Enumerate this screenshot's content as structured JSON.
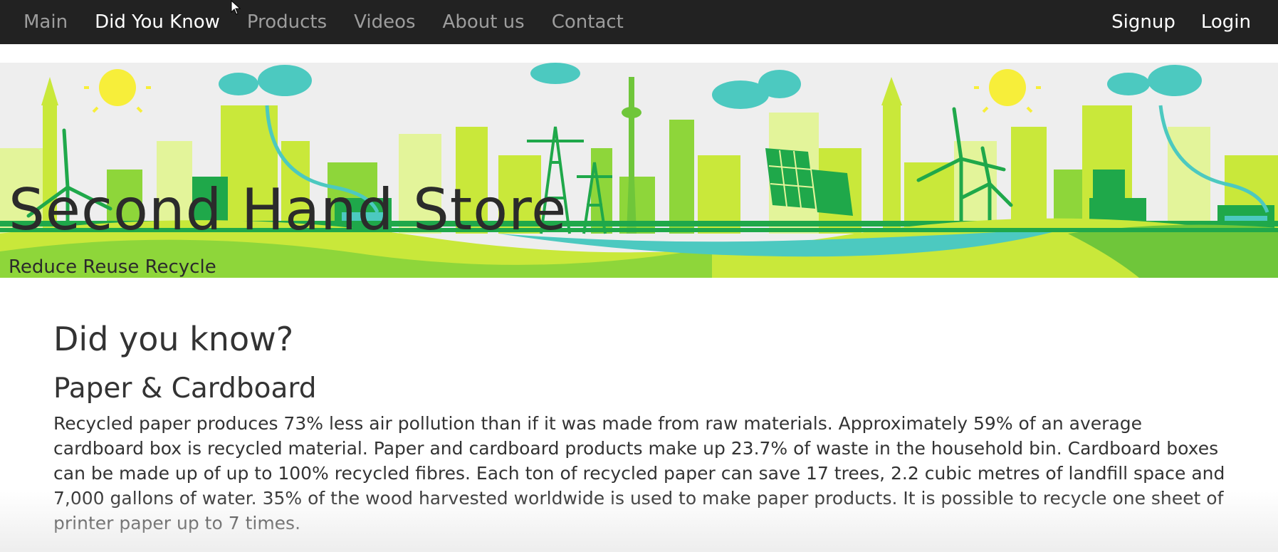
{
  "nav": {
    "left": [
      {
        "label": "Main",
        "active": false
      },
      {
        "label": "Did You Know",
        "active": true
      },
      {
        "label": "Products",
        "active": false
      },
      {
        "label": "Videos",
        "active": false
      },
      {
        "label": "About us",
        "active": false
      },
      {
        "label": "Contact",
        "active": false
      }
    ],
    "signup_label": "Signup",
    "login_label": "Login"
  },
  "banner": {
    "title": "Second Hand Store",
    "subtitle": "Reduce Reuse Recycle"
  },
  "content": {
    "heading": "Did you know?",
    "subheading": "Paper & Cardboard",
    "paragraph": "Recycled paper produces 73% less air pollution than if it was made from raw materials. Approximately 59% of an average cardboard box is recycled material. Paper and cardboard products make up 23.7% of waste in the household bin. Cardboard boxes can be made up of up to 100% recycled fibres. Each ton of recycled paper can save 17 trees, 2.2 cubic metres of landfill space and 7,000 gallons of water. 35% of the wood harvested worldwide is used to make paper products. It is possible to recycle one sheet of printer paper up to 7 times."
  },
  "colors": {
    "navbar_bg": "#222222",
    "nav_inactive": "#9d9d9d",
    "nav_active": "#ffffff",
    "banner_lime": "#c9e83a",
    "banner_green": "#1fa84a",
    "banner_teal": "#4cc9c0"
  }
}
